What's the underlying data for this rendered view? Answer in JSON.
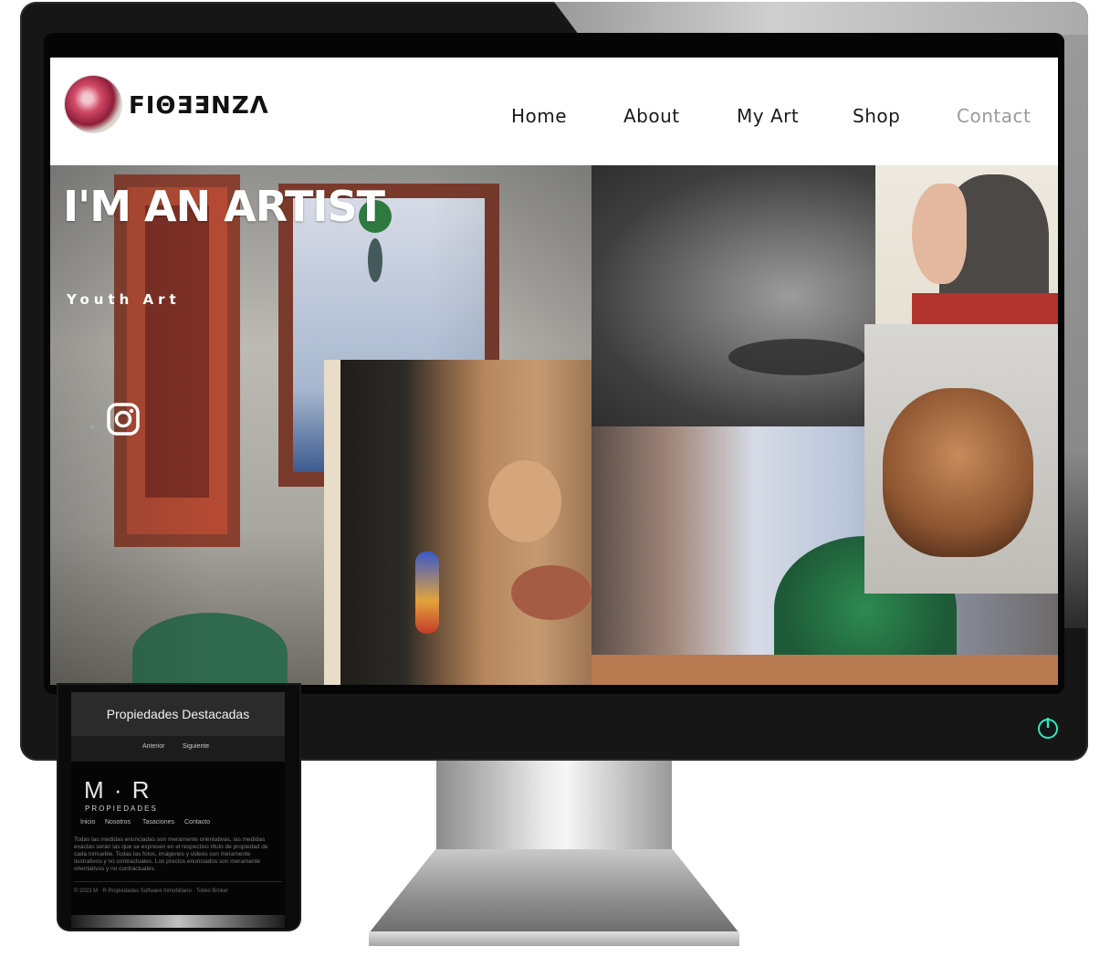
{
  "site": {
    "logo_text": "FIΘƎƎNZΛ",
    "nav": [
      "Home",
      "About",
      "My Art",
      "Shop",
      "Contact"
    ],
    "active_nav": "Contact"
  },
  "hero": {
    "title": "I'M AN ARTIST",
    "subtitle": "Youth Art"
  },
  "phone": {
    "featured_title": "Propiedades Destacadas",
    "pager": {
      "prev": "Anterior",
      "next": "Siguiente"
    },
    "brand": "M · R",
    "brand_sub": "PROPIEDADES",
    "menu": [
      "Inicio",
      "Nosotros",
      "Tasaciones",
      "Contacto"
    ],
    "legal": "Todas las medidas enunciadas son meramente orientativas, las medidas exactas serán las que se expresen en el respectivo título de propiedad de cada inmueble. Todas las fotos, imágenes y videos son meramente ilustrativos y no contractuales. Los precios enunciados son meramente orientativos y no contractuales.",
    "copyright": "© 2023 M · R Propiedades Software Inmobiliario · Tokko Broker"
  },
  "colors": {
    "nav_text": "#1a1a1a",
    "nav_active": "#9a9a9a",
    "power_accent": "#2ee8c0"
  }
}
